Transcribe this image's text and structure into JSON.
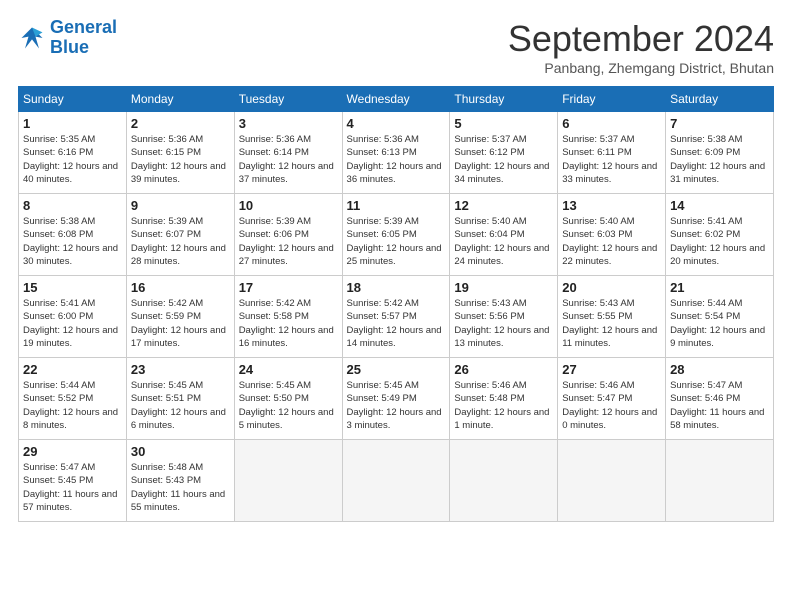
{
  "logo": {
    "line1": "General",
    "line2": "Blue"
  },
  "title": "September 2024",
  "subtitle": "Panbang, Zhemgang District, Bhutan",
  "days_of_week": [
    "Sunday",
    "Monday",
    "Tuesday",
    "Wednesday",
    "Thursday",
    "Friday",
    "Saturday"
  ],
  "weeks": [
    [
      {
        "day": 1,
        "sunrise": "5:35 AM",
        "sunset": "6:16 PM",
        "daylight": "12 hours and 40 minutes."
      },
      {
        "day": 2,
        "sunrise": "5:36 AM",
        "sunset": "6:15 PM",
        "daylight": "12 hours and 39 minutes."
      },
      {
        "day": 3,
        "sunrise": "5:36 AM",
        "sunset": "6:14 PM",
        "daylight": "12 hours and 37 minutes."
      },
      {
        "day": 4,
        "sunrise": "5:36 AM",
        "sunset": "6:13 PM",
        "daylight": "12 hours and 36 minutes."
      },
      {
        "day": 5,
        "sunrise": "5:37 AM",
        "sunset": "6:12 PM",
        "daylight": "12 hours and 34 minutes."
      },
      {
        "day": 6,
        "sunrise": "5:37 AM",
        "sunset": "6:11 PM",
        "daylight": "12 hours and 33 minutes."
      },
      {
        "day": 7,
        "sunrise": "5:38 AM",
        "sunset": "6:09 PM",
        "daylight": "12 hours and 31 minutes."
      }
    ],
    [
      {
        "day": 8,
        "sunrise": "5:38 AM",
        "sunset": "6:08 PM",
        "daylight": "12 hours and 30 minutes."
      },
      {
        "day": 9,
        "sunrise": "5:39 AM",
        "sunset": "6:07 PM",
        "daylight": "12 hours and 28 minutes."
      },
      {
        "day": 10,
        "sunrise": "5:39 AM",
        "sunset": "6:06 PM",
        "daylight": "12 hours and 27 minutes."
      },
      {
        "day": 11,
        "sunrise": "5:39 AM",
        "sunset": "6:05 PM",
        "daylight": "12 hours and 25 minutes."
      },
      {
        "day": 12,
        "sunrise": "5:40 AM",
        "sunset": "6:04 PM",
        "daylight": "12 hours and 24 minutes."
      },
      {
        "day": 13,
        "sunrise": "5:40 AM",
        "sunset": "6:03 PM",
        "daylight": "12 hours and 22 minutes."
      },
      {
        "day": 14,
        "sunrise": "5:41 AM",
        "sunset": "6:02 PM",
        "daylight": "12 hours and 20 minutes."
      }
    ],
    [
      {
        "day": 15,
        "sunrise": "5:41 AM",
        "sunset": "6:00 PM",
        "daylight": "12 hours and 19 minutes."
      },
      {
        "day": 16,
        "sunrise": "5:42 AM",
        "sunset": "5:59 PM",
        "daylight": "12 hours and 17 minutes."
      },
      {
        "day": 17,
        "sunrise": "5:42 AM",
        "sunset": "5:58 PM",
        "daylight": "12 hours and 16 minutes."
      },
      {
        "day": 18,
        "sunrise": "5:42 AM",
        "sunset": "5:57 PM",
        "daylight": "12 hours and 14 minutes."
      },
      {
        "day": 19,
        "sunrise": "5:43 AM",
        "sunset": "5:56 PM",
        "daylight": "12 hours and 13 minutes."
      },
      {
        "day": 20,
        "sunrise": "5:43 AM",
        "sunset": "5:55 PM",
        "daylight": "12 hours and 11 minutes."
      },
      {
        "day": 21,
        "sunrise": "5:44 AM",
        "sunset": "5:54 PM",
        "daylight": "12 hours and 9 minutes."
      }
    ],
    [
      {
        "day": 22,
        "sunrise": "5:44 AM",
        "sunset": "5:52 PM",
        "daylight": "12 hours and 8 minutes."
      },
      {
        "day": 23,
        "sunrise": "5:45 AM",
        "sunset": "5:51 PM",
        "daylight": "12 hours and 6 minutes."
      },
      {
        "day": 24,
        "sunrise": "5:45 AM",
        "sunset": "5:50 PM",
        "daylight": "12 hours and 5 minutes."
      },
      {
        "day": 25,
        "sunrise": "5:45 AM",
        "sunset": "5:49 PM",
        "daylight": "12 hours and 3 minutes."
      },
      {
        "day": 26,
        "sunrise": "5:46 AM",
        "sunset": "5:48 PM",
        "daylight": "12 hours and 1 minute."
      },
      {
        "day": 27,
        "sunrise": "5:46 AM",
        "sunset": "5:47 PM",
        "daylight": "12 hours and 0 minutes."
      },
      {
        "day": 28,
        "sunrise": "5:47 AM",
        "sunset": "5:46 PM",
        "daylight": "11 hours and 58 minutes."
      }
    ],
    [
      {
        "day": 29,
        "sunrise": "5:47 AM",
        "sunset": "5:45 PM",
        "daylight": "11 hours and 57 minutes."
      },
      {
        "day": 30,
        "sunrise": "5:48 AM",
        "sunset": "5:43 PM",
        "daylight": "11 hours and 55 minutes."
      },
      null,
      null,
      null,
      null,
      null
    ]
  ]
}
